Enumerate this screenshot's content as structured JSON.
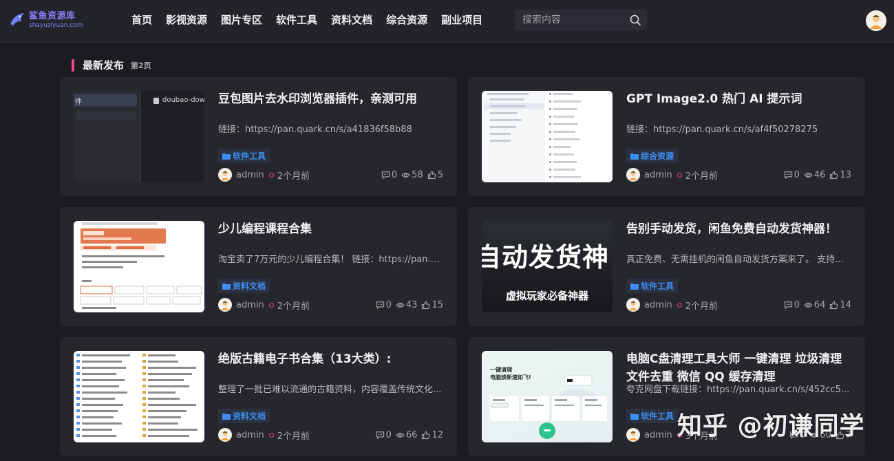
{
  "header": {
    "logo_title": "鲨鱼资源库",
    "logo_sub": "shayuziyuan.com",
    "nav": [
      "首页",
      "影视资源",
      "图片专区",
      "软件工具",
      "资料文档",
      "综合资源",
      "副业项目"
    ],
    "search_placeholder": "搜索内容"
  },
  "section": {
    "title": "最新发布",
    "page": "第2页"
  },
  "cards": [
    {
      "title": "豆包图片去水印浏览器插件，亲测可用",
      "desc": "链接：https://pan.quark.cn/s/a41836f58b88",
      "tag": "软件工具",
      "author": "admin",
      "time": "2个月前",
      "comments": "0",
      "views": "58",
      "likes": "5",
      "thumb_text": "doubao-downlo",
      "thumb_side": "件"
    },
    {
      "title": "GPT Image2.0 热门 AI 提示词",
      "desc": "链接：https://pan.quark.cn/s/af4f50278275",
      "tag": "综合资源",
      "author": "admin",
      "time": "2个月前",
      "comments": "0",
      "views": "46",
      "likes": "13"
    },
    {
      "title": "少儿编程课程合集",
      "desc": "淘宝卖了7万元的少儿编程合集！ 链接：https://pan.quark.cn/s/...",
      "tag": "资料文档",
      "author": "admin",
      "time": "2个月前",
      "comments": "0",
      "views": "43",
      "likes": "15"
    },
    {
      "title": "告别手动发货，闲鱼免费自动发货神器！",
      "desc": "真正免费、无需挂机的闲鱼自动发货方案来了。 支持...",
      "tag": "软件工具",
      "author": "admin",
      "time": "2个月前",
      "comments": "0",
      "views": "64",
      "likes": "14",
      "thumb_big": "自动发货神",
      "thumb_small": "虚拟玩家必备神器"
    },
    {
      "title": "绝版古籍电子书合集（13大类）:",
      "desc": "整理了一批已难以流通的古籍资料，内容覆盖传统文化...",
      "tag": "资料文档",
      "author": "admin",
      "time": "2个月前",
      "comments": "0",
      "views": "66",
      "likes": "12"
    },
    {
      "title": "电脑C盘清理工具大师 一键清理 垃圾清理 文件去重 微信 QQ 缓存清理",
      "desc": "夸克网盘下载链接：https://pan.quark.cn/s/452cc5...",
      "tag": "软件工具",
      "author": "admin",
      "time": "3个月前",
      "comments": "0",
      "views": "60",
      "likes": "7",
      "thumb_heading": "一键清理\n电脑焕新速如飞!"
    }
  ],
  "watermark": "知乎 @初谦同学"
}
